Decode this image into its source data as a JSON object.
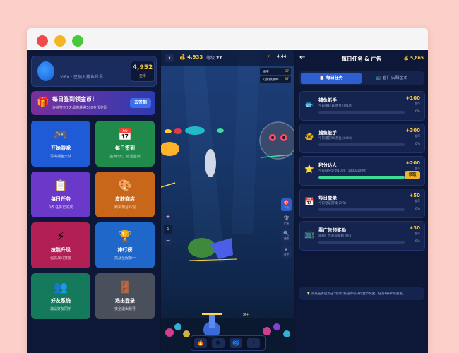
{
  "left": {
    "vip_text": "VIP0 · 已加入捕鱼世界",
    "gold": "4,952",
    "gold_label": "金币",
    "checkin": {
      "title": "每日签到领金币！",
      "subtitle": "连续签到7天最高获得500金币奖励",
      "button": "去签到"
    },
    "tiles": [
      {
        "label": "开始游戏",
        "sub": "深海捕鱼大战",
        "icon": "🎮",
        "color": "#1f5bd6"
      },
      {
        "label": "每日签到",
        "sub": "签到0天，点击签到",
        "icon": "📅",
        "color": "#1f8a4a"
      },
      {
        "label": "每日任务",
        "sub": "0/5 任务已完成",
        "icon": "📋",
        "color": "#6b39c9"
      },
      {
        "label": "皮肤商店",
        "sub": "购买炮台外观",
        "icon": "🎨",
        "color": "#c8661a"
      },
      {
        "label": "技能升级",
        "sub": "强化战斗技能",
        "icon": "⚡",
        "color": "#b21f55"
      },
      {
        "label": "排行榜",
        "sub": "挑战全服第一",
        "icon": "🏆",
        "color": "#1f68c9"
      },
      {
        "label": "好友系统",
        "sub": "邀请好友同乐",
        "icon": "👥",
        "color": "#15795b"
      },
      {
        "label": "退出登录",
        "sub": "安全退出账号",
        "icon": "🚪",
        "color": "#4a4f5c"
      }
    ]
  },
  "game": {
    "coins": "4,933",
    "level_label": "等级",
    "level": "27",
    "time": "4:44",
    "ranks": [
      {
        "name": "渔王",
        "value": "37"
      },
      {
        "name": "刀客麒麟网",
        "value": "37"
      }
    ],
    "zoom_level": "1",
    "zoom_in": "+",
    "zoom_out": "−",
    "tools": [
      {
        "label": "手动",
        "glyph": "🎯"
      },
      {
        "label": "护盾",
        "glyph": "🛡"
      },
      {
        "label": "追踪",
        "glyph": "🔍"
      },
      {
        "label": "暂停",
        "glyph": "⏸"
      }
    ],
    "fish_label": "渔王",
    "cannon_buttons": [
      "🔥",
      "❄",
      "🌀",
      "⚡"
    ]
  },
  "right": {
    "title": "每日任务 & 广告",
    "coins": "5,865",
    "tab_tasks": "📋 每日任务",
    "tab_ads": "📺 看广告赚金币",
    "tasks": [
      {
        "icon": "🐟",
        "name": "捕鱼新手",
        "desc": "今日捕获10条鱼 (0/10)",
        "reward": "+100",
        "unit": "金币",
        "pct": "0%",
        "progress": 0
      },
      {
        "icon": "🐠",
        "name": "捕鱼能手",
        "desc": "今日捕获50条鱼 (0/50)",
        "reward": "+300",
        "unit": "金币",
        "pct": "0%",
        "progress": 0
      },
      {
        "icon": "⭐",
        "name": "积分达人",
        "desc": "今日得分达到1000 (1000/1000)",
        "reward": "+200",
        "unit": "金币",
        "claim": "领取",
        "progress": 1
      },
      {
        "icon": "📅",
        "name": "每日登录",
        "desc": "今日登录游戏 (0/1)",
        "reward": "+50",
        "unit": "金币",
        "pct": "0%",
        "progress": 0
      },
      {
        "icon": "📺",
        "name": "看广告领奖励",
        "desc": "观看广告获得奖励 (0/1)",
        "reward": "+30",
        "unit": "金币",
        "pct": "0%",
        "progress": 0
      }
    ],
    "note": "💡 完成任务后点击“领取”按钮即可获得金币奖励。任务每日0点重置。"
  }
}
